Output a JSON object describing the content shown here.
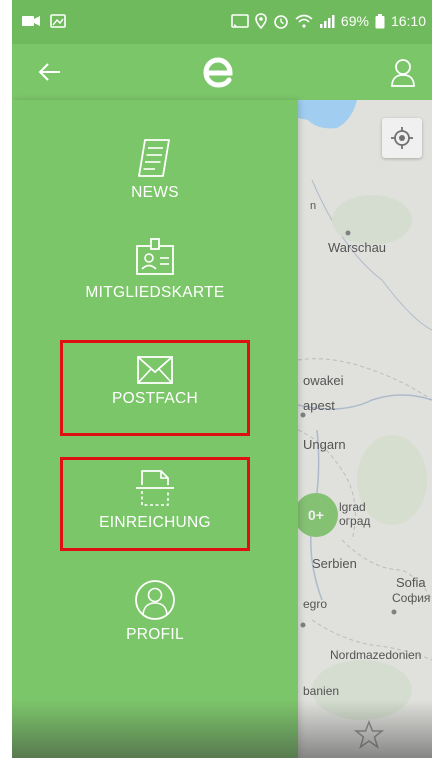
{
  "status_bar": {
    "battery_percent": "69%",
    "time": "16:10"
  },
  "app_bar": {
    "logo_letter": "e"
  },
  "menu": {
    "items": [
      {
        "label": "NEWS",
        "icon": "news-icon"
      },
      {
        "label": "MITGLIEDSKARTE",
        "icon": "membership-card-icon"
      },
      {
        "label": "POSTFACH",
        "icon": "envelope-icon",
        "highlighted": true
      },
      {
        "label": "EINREICHUNG",
        "icon": "document-scan-icon",
        "highlighted": true
      },
      {
        "label": "PROFIL",
        "icon": "profile-icon"
      }
    ]
  },
  "map": {
    "labels": {
      "warsaw": "Warschau",
      "slovakia": "owakei",
      "budapest": "apest",
      "hungary": "Ungarn",
      "belgrade_latin": "lgrad",
      "belgrade_cyrillic": "оград",
      "serbia": "Serbien",
      "sofia": "Sofia",
      "sofia_cyrillic": "София",
      "montenegro": "egro",
      "north_macedonia": "Nordmazedonien",
      "albania": "banien"
    },
    "cluster_label": "0+"
  },
  "colors": {
    "brand_green": "#7cc66a",
    "highlight_red": "#e01010"
  }
}
